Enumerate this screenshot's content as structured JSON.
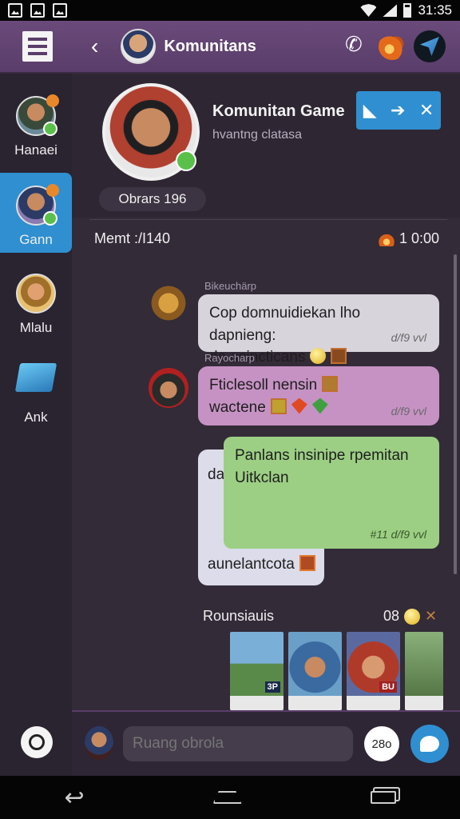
{
  "status_bar": {
    "time": "31:35"
  },
  "header": {
    "title": "Komunitans"
  },
  "sidebar": {
    "items": [
      {
        "label": "Hanaei"
      },
      {
        "label": "Gann"
      },
      {
        "label": "Mlalu"
      },
      {
        "label": "Ank"
      }
    ],
    "active_index": 1
  },
  "profile": {
    "title": "Komunitan Game",
    "subtitle": "hvantng clatasa",
    "members": "Obrars 196"
  },
  "meta": {
    "left": "Memt :/I140",
    "right": "1 0:00"
  },
  "messages": [
    {
      "sender": "Bikeuchärp",
      "text_line1": "Cop domnuidiekan lho dapnieng:",
      "text_line2": "de asincticans",
      "time": "d/f9 vvl"
    },
    {
      "sender": "Rayocharp",
      "text_line1": "Fticlesoll nensin",
      "text_line2": "wactene",
      "time": "d/f9 vvl"
    },
    {
      "prefix": "da",
      "text_line1": "Panlans insinipe rpemitan",
      "text_line2": "Uitkclan",
      "time": "#11 d/f9 vvl",
      "footer": "aunelantcota"
    }
  ],
  "gallery": {
    "label": "Rounsiauis",
    "count": "08",
    "tags": [
      "3P",
      "",
      "BU",
      ""
    ]
  },
  "composer": {
    "placeholder": "Ruang obrola",
    "count": "28o"
  },
  "colors": {
    "accent": "#2f8fd0",
    "header": "#5a3d6a",
    "bubble_pink": "#c692c4",
    "bubble_green": "#9ccf84"
  }
}
